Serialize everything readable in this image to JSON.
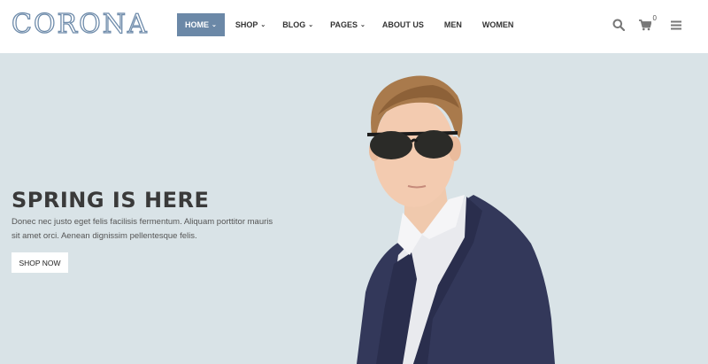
{
  "header": {
    "logo": "CORONA",
    "nav": [
      {
        "label": "HOME",
        "has_dropdown": true,
        "active": true
      },
      {
        "label": "SHOP",
        "has_dropdown": true
      },
      {
        "label": "BLOG",
        "has_dropdown": true
      },
      {
        "label": "PAGES",
        "has_dropdown": true
      },
      {
        "label": "ABOUT US",
        "has_dropdown": false
      },
      {
        "label": "MEN",
        "has_dropdown": false
      },
      {
        "label": "WOMEN",
        "has_dropdown": false
      }
    ],
    "icons": {
      "search": "search-icon",
      "cart": "cart-icon",
      "menu": "hamburger-menu-icon"
    },
    "cart_count": "0"
  },
  "hero": {
    "title": "SPRING IS HERE",
    "text": "Donec nec justo eget felis facilisis fermentum. Aliquam porttitor mauris sit amet orci. Aenean dignissim pellentesque felis.",
    "button": "SHOP NOW",
    "image": "model-in-sunglasses-image"
  },
  "colors": {
    "accent": "#6b88a7",
    "hero_bg": "#d9e3e7",
    "suit": "#33385a"
  }
}
